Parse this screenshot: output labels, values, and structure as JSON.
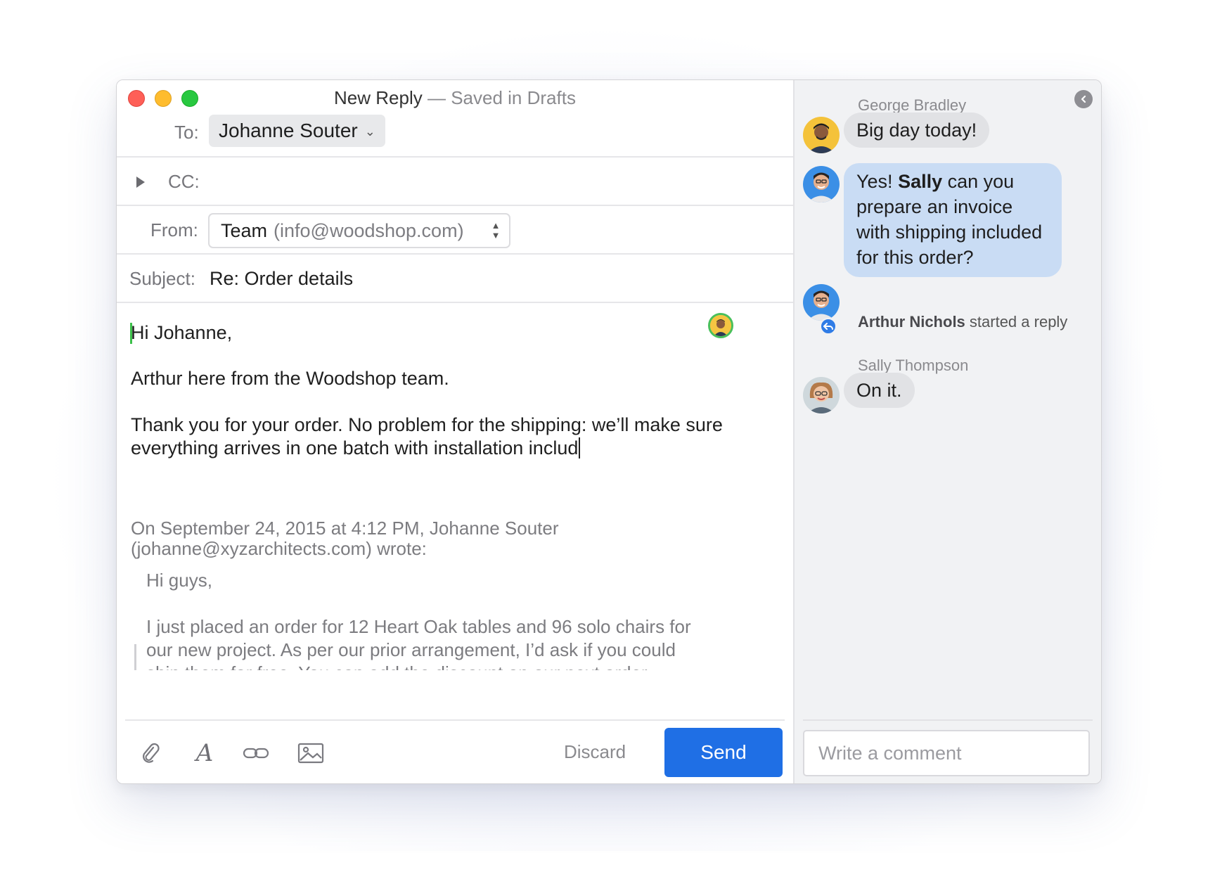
{
  "window": {
    "title_main": "New Reply",
    "title_sub": " — Saved in Drafts"
  },
  "compose": {
    "to_label": "To:",
    "to_value": "Johanne Souter",
    "cc_label": "CC:",
    "from_label": "From:",
    "from_name": "Team",
    "from_address": "(info@woodshop.com)",
    "subject_label": "Subject:",
    "subject_value": "Re: Order details",
    "body_lines": [
      "Hi Johanne,",
      "Arthur here from the Woodshop team.",
      "Thank you for your order. No problem for the shipping: we’ll make sure",
      "everything arrives in one batch with installation includ"
    ],
    "quote_header": [
      "On September 24, 2015 at 4:12 PM, Johanne Souter",
      "(johanne@xyzarchitects.com) wrote:"
    ],
    "quote_lines": [
      "Hi guys,",
      "I just placed an order for 12 Heart Oak tables and 96 solo chairs for",
      "our new project. As per our prior arrangement, I’d ask if you could",
      "ship them for free. You can add the discount on our next order."
    ]
  },
  "toolbar": {
    "attach_icon": "paperclip-icon",
    "format_icon": "font-icon",
    "link_icon": "link-icon",
    "image_icon": "image-icon",
    "discard_label": "Discard",
    "send_label": "Send",
    "send_color": "#1f6fe5"
  },
  "comments": {
    "messages": [
      {
        "author": "George Bradley",
        "text": "Big day today!"
      },
      {
        "author": "",
        "pre": "Yes! ",
        "bold": "Sally",
        "post": " can you prepare an invoice with shipping included for this order?"
      },
      {
        "author": "Sally Thompson",
        "text": "On it."
      }
    ],
    "activity_name": "Arthur Nichols",
    "activity_text": " started a reply",
    "input_placeholder": "Write a comment"
  }
}
